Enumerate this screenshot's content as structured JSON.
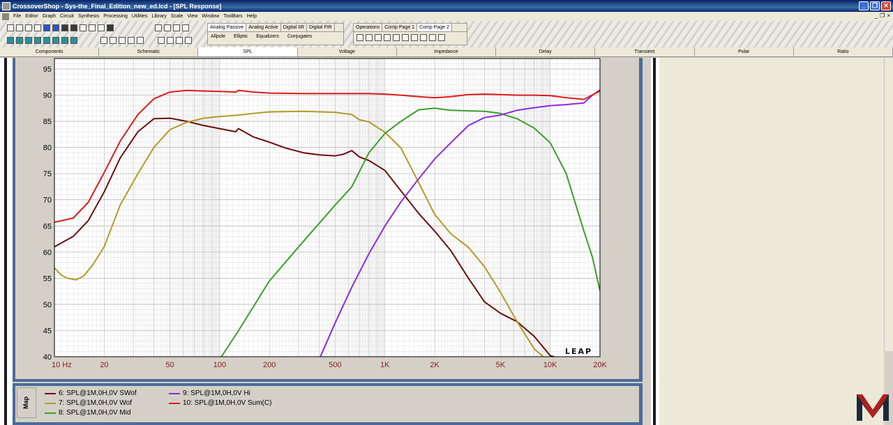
{
  "window": {
    "title": "CrossoverShop - Sys-the_Final_Edition_new_ed.lcd - [SPL Response]",
    "buttons": [
      "_",
      "❐",
      "✕"
    ]
  },
  "menu": {
    "items": [
      "File",
      "Editor",
      "Graph",
      "Circuit",
      "Synthesis",
      "Processing",
      "Utilities",
      "Library",
      "Scale",
      "View",
      "Window",
      "ToolBars",
      "Help"
    ],
    "mdi_buttons": [
      "_",
      "❐",
      "×"
    ]
  },
  "toolbar": {
    "synthesis_tabs": [
      "Analog Passive",
      "Analog Active",
      "Digital IIR",
      "Digital FIR"
    ],
    "synthesis_items": [
      "Allpole",
      "Elliptic",
      "Equalizers",
      "Conjugates"
    ],
    "ops_tabs": [
      "Operations",
      "Comp Page 1",
      "Comp Page 2"
    ]
  },
  "tabs": [
    "Components",
    "Schematic",
    "SPL",
    "Voltage",
    "Impedance",
    "Delay",
    "Transient",
    "Polar",
    "Ratio"
  ],
  "active_tab": "SPL",
  "graph": {
    "brand": "LEAP"
  },
  "legend": {
    "label": "Map",
    "items": [
      {
        "name": "6: SPL@1M,0H,0V SWof",
        "color": "#6b0f0f"
      },
      {
        "name": "7: SPL@1M,0H,0V Wof",
        "color": "#b49a2a"
      },
      {
        "name": "8: SPL@1M,0H,0V Mid",
        "color": "#3aa02a"
      },
      {
        "name": "9: SPL@1M,0H,0V Hi",
        "color": "#8a2be2"
      },
      {
        "name": "10: SPL@1M,0H,0V Sum(C)",
        "color": "#e01b1b"
      }
    ]
  },
  "chart_data": {
    "type": "line",
    "xscale": "log",
    "xlim": [
      10,
      20000
    ],
    "ylim": [
      40,
      97
    ],
    "x_ticks": [
      {
        "label": "10  Hz",
        "value": 10
      },
      {
        "label": "20",
        "value": 20
      },
      {
        "label": "50",
        "value": 50
      },
      {
        "label": "100",
        "value": 100
      },
      {
        "label": "200",
        "value": 200
      },
      {
        "label": "500",
        "value": 500
      },
      {
        "label": "1K",
        "value": 1000
      },
      {
        "label": "2K",
        "value": 2000
      },
      {
        "label": "5K",
        "value": 5000
      },
      {
        "label": "10K",
        "value": 10000
      },
      {
        "label": "20K",
        "value": 20000
      }
    ],
    "y_ticks": [
      40,
      45,
      50,
      55,
      60,
      65,
      70,
      75,
      80,
      85,
      90,
      95
    ],
    "grid": true,
    "series": [
      {
        "name": "6: SPL@1M,0H,0V SWof",
        "color": "#6b0f0f",
        "x": [
          10,
          13,
          16,
          20,
          25,
          32,
          40,
          50,
          63,
          80,
          100,
          125,
          130,
          160,
          200,
          250,
          320,
          400,
          500,
          560,
          630,
          700,
          800,
          1000,
          1250,
          1600,
          2000,
          2500,
          3200,
          4000,
          5000,
          6300,
          8000,
          10000,
          12000
        ],
        "y": [
          61,
          63,
          66,
          71.5,
          78,
          83,
          85.5,
          85.6,
          85.0,
          84.2,
          83.6,
          83.0,
          83.6,
          82.0,
          81.0,
          79.9,
          79.0,
          78.6,
          78.4,
          78.7,
          79.4,
          78.2,
          77.5,
          75.6,
          71.7,
          67.4,
          64.0,
          60.3,
          55.0,
          50.5,
          48.3,
          46.7,
          43.9,
          40.2,
          39.5
        ]
      },
      {
        "name": "7: SPL@1M,0H,0V Wof",
        "color": "#b49a2a",
        "x": [
          10,
          11,
          12,
          13.5,
          15,
          17,
          20,
          25,
          32,
          40,
          50,
          63,
          80,
          100,
          130,
          160,
          200,
          320,
          500,
          630,
          700,
          800,
          1000,
          1250,
          1600,
          2000,
          2500,
          3200,
          4000,
          5000,
          6300,
          8000,
          9500
        ],
        "y": [
          57,
          55.6,
          55,
          54.7,
          55.4,
          57.5,
          61,
          69,
          75,
          80,
          83.4,
          84.8,
          85.6,
          85.9,
          86.2,
          86.5,
          86.8,
          86.9,
          86.7,
          86.3,
          85.3,
          84.9,
          82.9,
          79.9,
          73.3,
          67.2,
          63.5,
          60.9,
          57.2,
          52.3,
          46.7,
          41.5,
          39.5
        ]
      },
      {
        "name": "8: SPL@1M,0H,0V Mid",
        "color": "#3aa02a",
        "x": [
          100,
          130,
          200,
          320,
          500,
          630,
          800,
          1000,
          1250,
          1600,
          2000,
          2500,
          3200,
          4000,
          5000,
          6300,
          8000,
          10000,
          12500,
          16000,
          18000,
          20000
        ],
        "y": [
          39.5,
          45,
          54.5,
          62,
          69,
          72.5,
          79,
          82.7,
          85,
          87.2,
          87.5,
          87.1,
          87.0,
          86.9,
          86.5,
          85.5,
          83.7,
          80.9,
          75,
          64,
          59,
          52.6
        ]
      },
      {
        "name": "9: SPL@1M,0H,0V Hi",
        "color": "#8a2be2",
        "x": [
          400,
          500,
          630,
          800,
          1000,
          1250,
          1600,
          2000,
          2500,
          3200,
          4000,
          5000,
          6300,
          8000,
          10000,
          12500,
          16000,
          18000,
          20000
        ],
        "y": [
          39.5,
          46.5,
          53.3,
          59.7,
          65.0,
          69.6,
          74.0,
          77.8,
          80.9,
          84.2,
          85.7,
          86.2,
          87.1,
          87.6,
          88.0,
          88.2,
          88.5,
          90.0,
          91.0
        ]
      },
      {
        "name": "10: SPL@1M,0H,0V Sum(C)",
        "color": "#e01b1b",
        "x": [
          10,
          13,
          16,
          20,
          25,
          32,
          40,
          50,
          63,
          80,
          100,
          125,
          130,
          160,
          200,
          320,
          500,
          630,
          800,
          1000,
          1250,
          1600,
          2000,
          2500,
          3200,
          4000,
          5000,
          6300,
          8000,
          10000,
          12500,
          16000,
          20000
        ],
        "y": [
          65.7,
          66.5,
          69.5,
          75.2,
          81.2,
          86.3,
          89.3,
          90.6,
          90.9,
          90.8,
          90.7,
          90.6,
          90.9,
          90.6,
          90.4,
          90.3,
          90.3,
          90.3,
          90.3,
          90.2,
          90.0,
          89.7,
          89.5,
          89.7,
          90.1,
          90.2,
          90.1,
          90.0,
          90.0,
          89.9,
          89.5,
          89.2,
          90.8
        ]
      }
    ]
  }
}
